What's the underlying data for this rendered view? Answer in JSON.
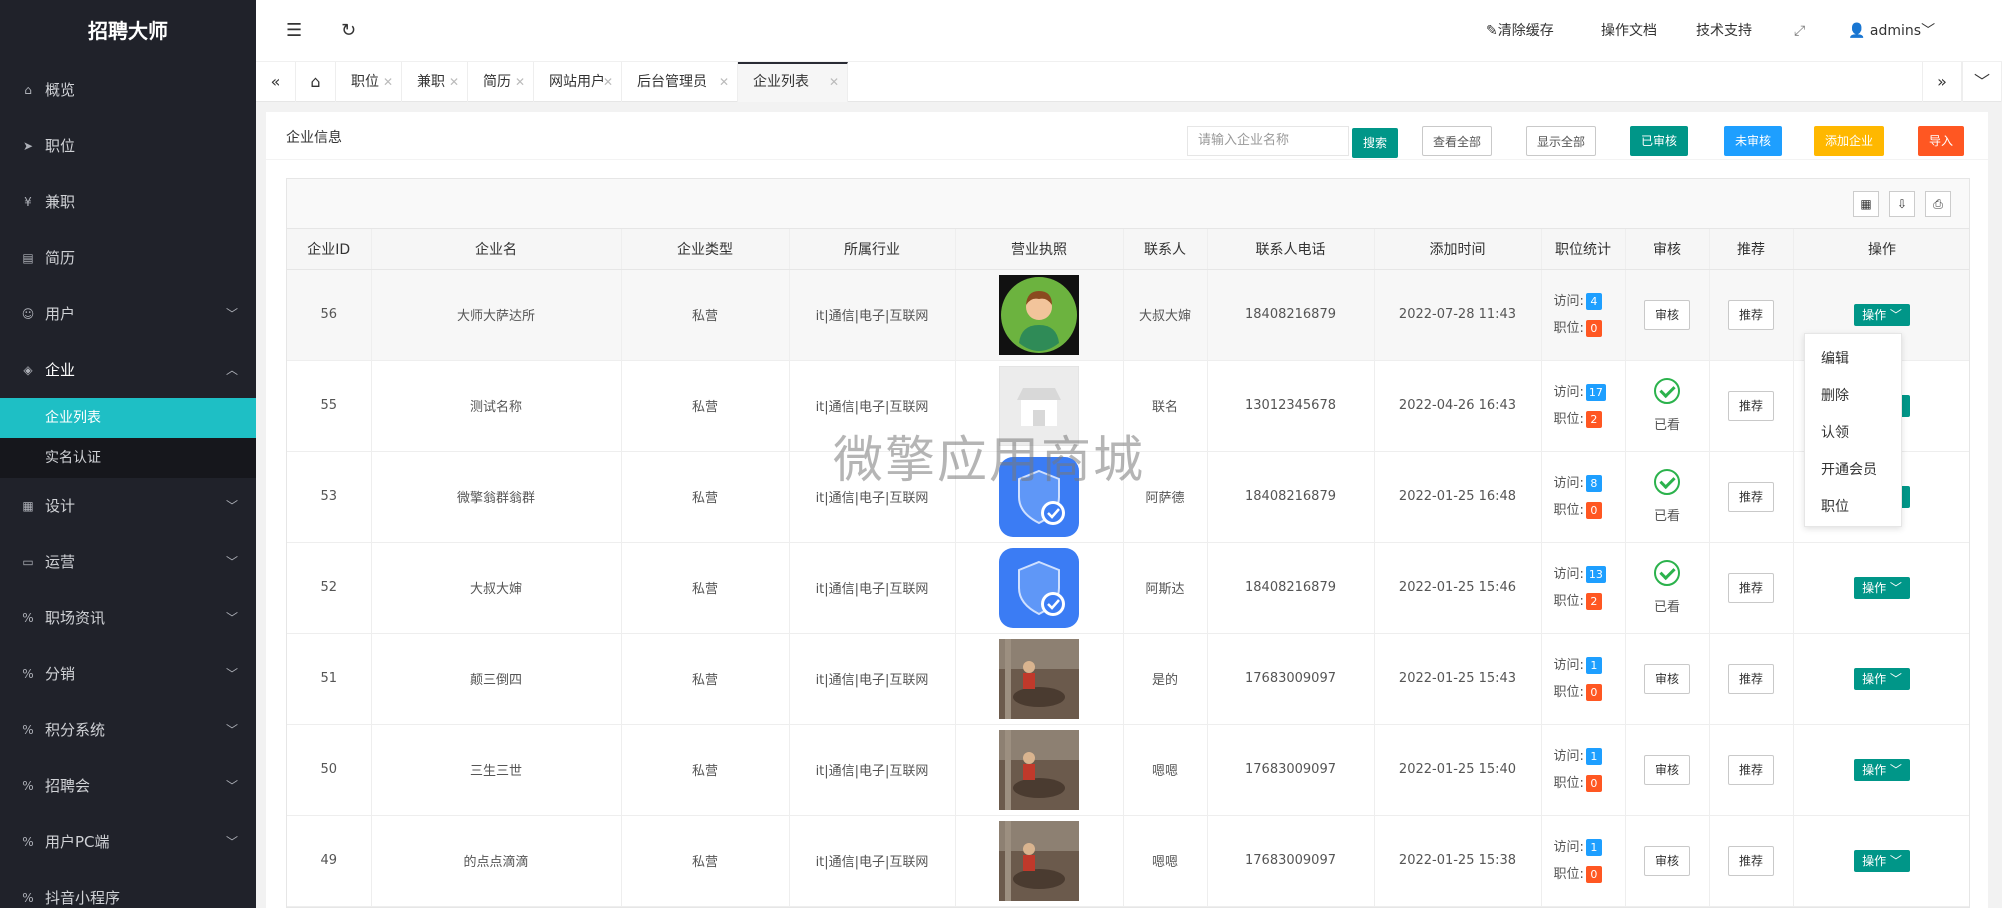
{
  "app": {
    "title": "招聘大师"
  },
  "sidebar": {
    "items": [
      {
        "label": "概览",
        "icon": "home-icon"
      },
      {
        "label": "职位",
        "icon": "send-icon"
      },
      {
        "label": "兼职",
        "icon": "yen-icon"
      },
      {
        "label": "简历",
        "icon": "file-icon"
      },
      {
        "label": "用户",
        "icon": "user-icon"
      },
      {
        "label": "企业",
        "icon": "shield-icon"
      }
    ],
    "sub_items": [
      {
        "label": "企业列表"
      },
      {
        "label": "实名认证"
      }
    ],
    "items_after": [
      {
        "label": "设计",
        "icon": "calendar-icon"
      },
      {
        "label": "运营",
        "icon": "keyboard-icon"
      },
      {
        "label": "职场资讯",
        "icon": "percent-icon"
      },
      {
        "label": "分销",
        "icon": "percent-icon"
      },
      {
        "label": "积分系统",
        "icon": "percent-icon"
      },
      {
        "label": "招聘会",
        "icon": "percent-icon"
      },
      {
        "label": "用户PC端",
        "icon": "percent-icon"
      },
      {
        "label": "抖音小程序",
        "icon": "percent-icon"
      }
    ]
  },
  "header": {
    "clear_cache": "清除缓存",
    "docs": "操作文档",
    "support": "技术支持",
    "user": "admins"
  },
  "tabs": [
    {
      "label": "职位"
    },
    {
      "label": "兼职"
    },
    {
      "label": "简历"
    },
    {
      "label": "网站用户"
    },
    {
      "label": "后台管理员"
    },
    {
      "label": "企业列表"
    }
  ],
  "card": {
    "title": "企业信息",
    "search_placeholder": "请输入企业名称",
    "search_btn": "搜索",
    "view_all": "查看全部",
    "show_all": "显示全部",
    "approved": "已审核",
    "unapproved": "未审核",
    "add": "添加企业",
    "import": "导入"
  },
  "table": {
    "headers": [
      "企业ID",
      "企业名",
      "企业类型",
      "所属行业",
      "营业执照",
      "联系人",
      "联系人电话",
      "添加时间",
      "职位统计",
      "审核",
      "推荐",
      "操作"
    ],
    "visit_label": "访问:",
    "job_label": "职位:",
    "audit_btn": "审核",
    "seen_label": "已看",
    "recommend_btn": "推荐",
    "op_btn": "操作",
    "rows": [
      {
        "id": "56",
        "name": "大师大萨达所",
        "type": "私营",
        "industry": "it|通信|电子|互联网",
        "license": "avatar",
        "contact": "大叔大婶",
        "phone": "18408216879",
        "time": "2022-07-28 11:43",
        "visits": "4",
        "jobs": "0",
        "audited": false
      },
      {
        "id": "55",
        "name": "测试名称",
        "type": "私营",
        "industry": "it|通信|电子|互联网",
        "license": "store",
        "contact": "联名",
        "phone": "13012345678",
        "time": "2022-04-26 16:43",
        "visits": "17",
        "jobs": "2",
        "audited": true
      },
      {
        "id": "53",
        "name": "微擎翁群翁群",
        "type": "私营",
        "industry": "it|通信|电子|互联网",
        "license": "shield",
        "contact": "阿萨德",
        "phone": "18408216879",
        "time": "2022-01-25 16:48",
        "visits": "8",
        "jobs": "0",
        "audited": true
      },
      {
        "id": "52",
        "name": "大叔大婶",
        "type": "私营",
        "industry": "it|通信|电子|互联网",
        "license": "shield",
        "contact": "阿斯达",
        "phone": "18408216879",
        "time": "2022-01-25 15:46",
        "visits": "13",
        "jobs": "2",
        "audited": true
      },
      {
        "id": "51",
        "name": "颠三倒四",
        "type": "私营",
        "industry": "it|通信|电子|互联网",
        "license": "photo",
        "contact": "是的",
        "phone": "17683009097",
        "time": "2022-01-25 15:43",
        "visits": "1",
        "jobs": "0",
        "audited": false
      },
      {
        "id": "50",
        "name": "三生三世",
        "type": "私营",
        "industry": "it|通信|电子|互联网",
        "license": "photo",
        "contact": "嗯嗯",
        "phone": "17683009097",
        "time": "2022-01-25 15:40",
        "visits": "1",
        "jobs": "0",
        "audited": false
      },
      {
        "id": "49",
        "name": "的点点滴滴",
        "type": "私营",
        "industry": "it|通信|电子|互联网",
        "license": "photo",
        "contact": "嗯嗯",
        "phone": "17683009097",
        "time": "2022-01-25 15:38",
        "visits": "1",
        "jobs": "0",
        "audited": false
      }
    ]
  },
  "dropdown": {
    "items": [
      "编辑",
      "删除",
      "认领",
      "开通会员",
      "职位"
    ]
  },
  "watermark": "微擎应用商城",
  "colors": {
    "sidebar_bg": "#20222a",
    "accent": "#1ebfc5",
    "green": "#009688",
    "blue": "#1e9fff",
    "orange": "#ffb800",
    "red": "#ff5722"
  }
}
